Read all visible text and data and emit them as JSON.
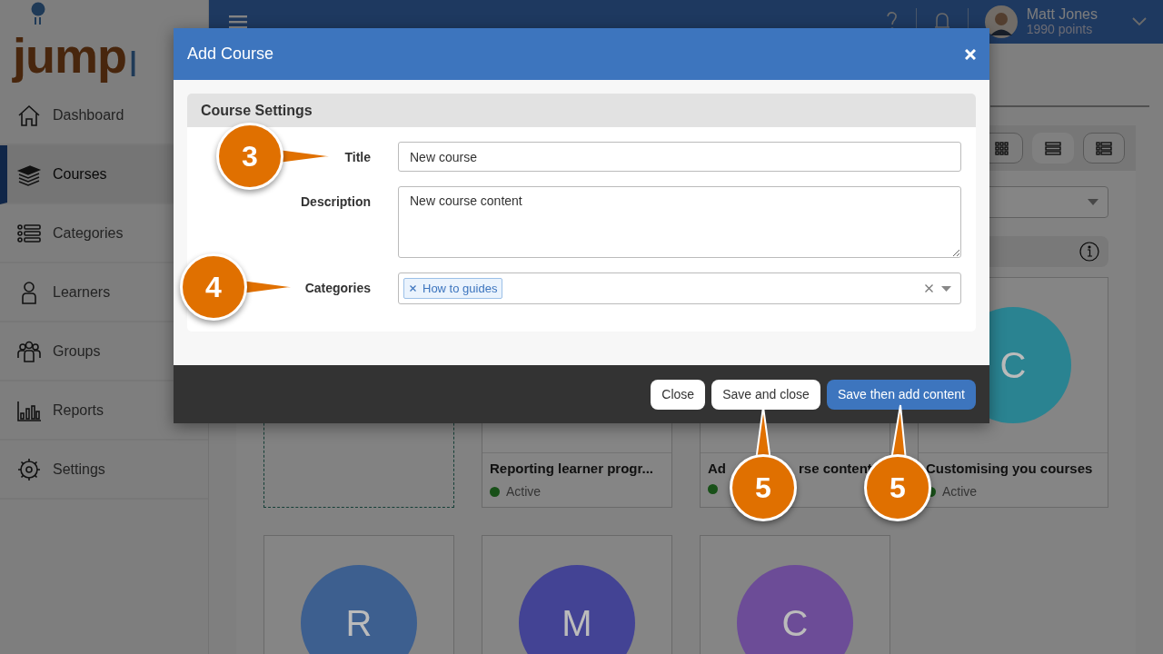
{
  "logo": {
    "text": "jump",
    "suffix": "I"
  },
  "header": {
    "user": {
      "name": "Matt Jones",
      "points": "1990 points"
    }
  },
  "sidebar": {
    "items": [
      {
        "label": "Dashboard",
        "kind": "home",
        "selected": false
      },
      {
        "label": "Courses",
        "kind": "stack",
        "selected": true
      },
      {
        "label": "Categories",
        "kind": "list",
        "selected": false
      },
      {
        "label": "Learners",
        "kind": "person",
        "selected": false
      },
      {
        "label": "Groups",
        "kind": "people",
        "selected": false
      },
      {
        "label": "Reports",
        "kind": "chart",
        "selected": false
      },
      {
        "label": "Settings",
        "kind": "gear",
        "selected": false
      }
    ]
  },
  "view_buttons": [
    {
      "kind": "grid",
      "selected": false
    },
    {
      "kind": "rows",
      "selected": true
    },
    {
      "kind": "list",
      "selected": false
    }
  ],
  "courses": [
    {
      "kind": "placeholder"
    },
    {
      "kind": "course",
      "title_parts": [
        "Reporting learner progr..."
      ],
      "status": "Active"
    },
    {
      "kind": "course",
      "title_parts": [
        "Ad",
        "rse content"
      ]
    },
    {
      "kind": "course",
      "initial": "C",
      "color": "#2a8391",
      "title_parts": [
        "Customising you courses"
      ],
      "status": "Active"
    },
    {
      "kind": "course",
      "initial": "R",
      "color": "#3d5f8f"
    },
    {
      "kind": "course",
      "initial": "M",
      "color": "#434394"
    },
    {
      "kind": "course",
      "initial": "C",
      "color": "#6c4c97"
    }
  ],
  "modal": {
    "title": "Add Course",
    "section": "Course Settings",
    "fields": [
      {
        "kind": "text",
        "label": "Title",
        "value": "New course"
      },
      {
        "kind": "textarea",
        "label": "Description",
        "value": "New course content"
      },
      {
        "kind": "tags",
        "label": "Categories",
        "tags": [
          "How to guides"
        ]
      }
    ],
    "buttons": [
      {
        "label": "Close",
        "kind": "default"
      },
      {
        "label": "Save and close",
        "kind": "default"
      },
      {
        "label": "Save then add content",
        "kind": "primary"
      }
    ]
  },
  "callouts": [
    {
      "number": "3"
    },
    {
      "number": "4"
    },
    {
      "number": "5"
    },
    {
      "number": "5"
    }
  ]
}
